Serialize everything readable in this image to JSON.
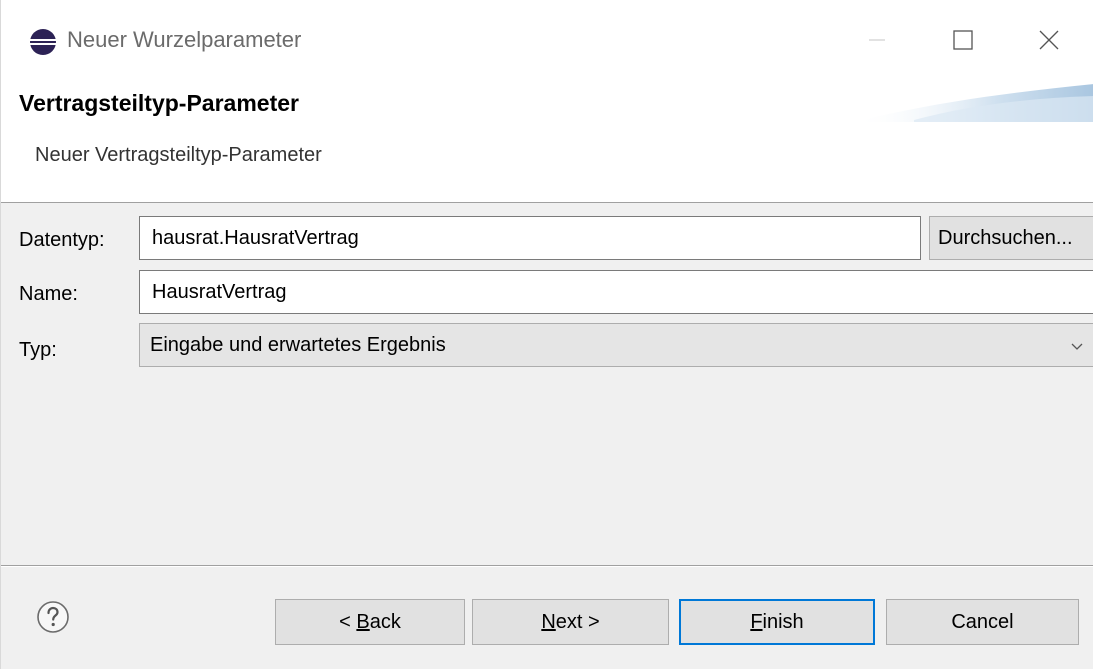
{
  "window": {
    "title": "Neuer Wurzelparameter"
  },
  "header": {
    "title": "Vertragsteiltyp-Parameter",
    "description": "Neuer Vertragsteiltyp-Parameter"
  },
  "form": {
    "datentyp": {
      "label": "Datentyp:",
      "value": "hausrat.HausratVertrag",
      "browse_label": "Durchsuchen..."
    },
    "name": {
      "label": "Name:",
      "value": "HausratVertrag"
    },
    "typ": {
      "label": "Typ:",
      "selected": "Eingabe und erwartetes Ergebnis"
    }
  },
  "buttons": {
    "back": {
      "prefix": "< ",
      "mnemonic": "B",
      "rest": "ack"
    },
    "next": {
      "mnemonic": "N",
      "rest": "ext >"
    },
    "finish": {
      "mnemonic": "F",
      "rest": "inish"
    },
    "cancel": "Cancel"
  },
  "icons": {
    "app": "eclipse-icon",
    "help": "help-icon",
    "minimize": "minimize-icon",
    "maximize": "maximize-icon",
    "close": "close-icon",
    "dropdown": "chevron-down-icon"
  },
  "colors": {
    "focus_border": "#0078d7",
    "button_bg": "#e1e1e1",
    "dialog_bg": "#f0f0f0"
  }
}
